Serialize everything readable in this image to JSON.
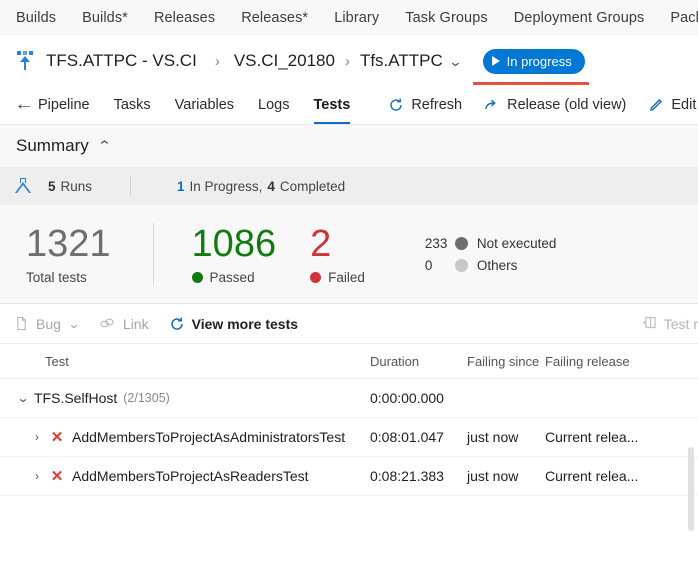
{
  "hub_nav": {
    "items": [
      {
        "label": "Builds"
      },
      {
        "label": "Builds*"
      },
      {
        "label": "Releases"
      },
      {
        "label": "Releases*"
      },
      {
        "label": "Library"
      },
      {
        "label": "Task Groups"
      },
      {
        "label": "Deployment Groups"
      },
      {
        "label": "Packages"
      }
    ]
  },
  "breadcrumb": {
    "release_icon": "release-icon",
    "items": [
      {
        "label": "TFS.ATTPC - VS.CI"
      },
      {
        "label": "VS.CI_20180"
      },
      {
        "label": "Tfs.ATTPC"
      }
    ],
    "separator": "›",
    "chevron": "⌄",
    "status": {
      "label": "In progress",
      "icon": "play-icon",
      "color": "#0078d4",
      "highlight_color": "#e8503a"
    }
  },
  "pivots": {
    "back_label": "Pipeline",
    "back_icon": "arrow-left-icon",
    "items": [
      {
        "label": "Tasks",
        "active": false
      },
      {
        "label": "Variables",
        "active": false
      },
      {
        "label": "Logs",
        "active": false
      },
      {
        "label": "Tests",
        "active": true
      }
    ],
    "commands": [
      {
        "label": "Refresh",
        "icon": "refresh-icon"
      },
      {
        "label": "Release (old view)",
        "icon": "share-arrow-icon"
      },
      {
        "label": "Edit re",
        "icon": "pencil-icon"
      }
    ]
  },
  "summary": {
    "title": "Summary",
    "collapse_icon": "chevron-up-icon",
    "runs": {
      "icon": "flask-icon",
      "count": "5",
      "label": "Runs",
      "in_progress_count": "1",
      "in_progress_label": "In Progress,",
      "completed_count": "4",
      "completed_label": "Completed"
    },
    "metrics": {
      "total": {
        "value": "1321",
        "label": "Total tests",
        "color": "#6e6e6e"
      },
      "passed": {
        "value": "1086",
        "label": "Passed",
        "color": "#107c10"
      },
      "failed": {
        "value": "2",
        "label": "Failed",
        "color": "#d13438"
      },
      "not_executed": {
        "value": "233",
        "label": "Not executed",
        "color": "#6e6e6e"
      },
      "others": {
        "value": "0",
        "label": "Others",
        "color": "#c8c8c8"
      }
    }
  },
  "toolbar": {
    "bug_label": "Bug",
    "bug_icon": "bug-file-icon",
    "bug_chevron": "⌄",
    "link_label": "Link",
    "link_icon": "link-icon",
    "view_more_label": "View more tests",
    "view_more_icon": "refresh-icon",
    "right_label": "Test r",
    "right_icon": "panel-icon"
  },
  "table": {
    "columns": [
      {
        "label": "Test"
      },
      {
        "label": "Duration"
      },
      {
        "label": "Failing since"
      },
      {
        "label": "Failing release"
      }
    ],
    "rows": [
      {
        "type": "group",
        "chevron": "⌄",
        "name": "TFS.SelfHost",
        "sub": "(2/1305)",
        "duration": "0:00:00.000",
        "failing_since": "",
        "failing_release": ""
      },
      {
        "type": "test",
        "chevron": "›",
        "status_icon": "failed-x-icon",
        "name": "AddMembersToProjectAsAdministratorsTest",
        "duration": "0:08:01.047",
        "failing_since": "just now",
        "failing_release": "Current relea..."
      },
      {
        "type": "test",
        "chevron": "›",
        "status_icon": "failed-x-icon",
        "name": "AddMembersToProjectAsReadersTest",
        "duration": "0:08:21.383",
        "failing_since": "just now",
        "failing_release": "Current relea..."
      }
    ]
  }
}
